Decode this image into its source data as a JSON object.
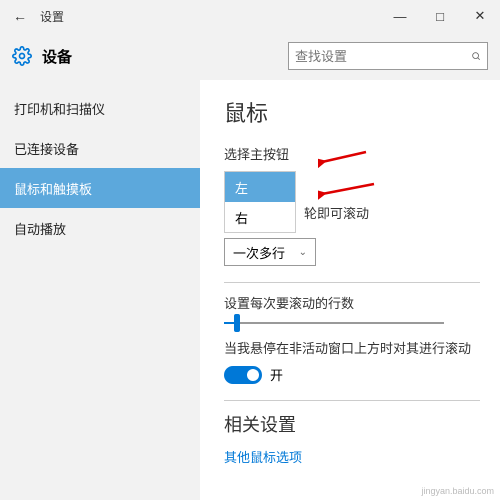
{
  "titlebar": {
    "back_glyph": "←",
    "title": "设置",
    "min": "—",
    "max": "□",
    "close": "✕"
  },
  "header": {
    "title": "设备",
    "search_placeholder": "查找设置"
  },
  "sidebar": {
    "items": [
      {
        "label": "打印机和扫描仪"
      },
      {
        "label": "已连接设备"
      },
      {
        "label": "鼠标和触摸板"
      },
      {
        "label": "自动播放"
      }
    ]
  },
  "main": {
    "heading": "鼠标",
    "primary_button_label": "选择主按钮",
    "primary_options": {
      "left": "左",
      "right": "右"
    },
    "scroll_suffix": "轮即可滚动",
    "scroll_select": "一次多行",
    "lines_label": "设置每次要滚动的行数",
    "hover_label": "当我悬停在非活动窗口上方时对其进行滚动",
    "toggle_on": "开",
    "related_heading": "相关设置",
    "related_link": "其他鼠标选项"
  },
  "watermark": "jingyan.baidu.com"
}
